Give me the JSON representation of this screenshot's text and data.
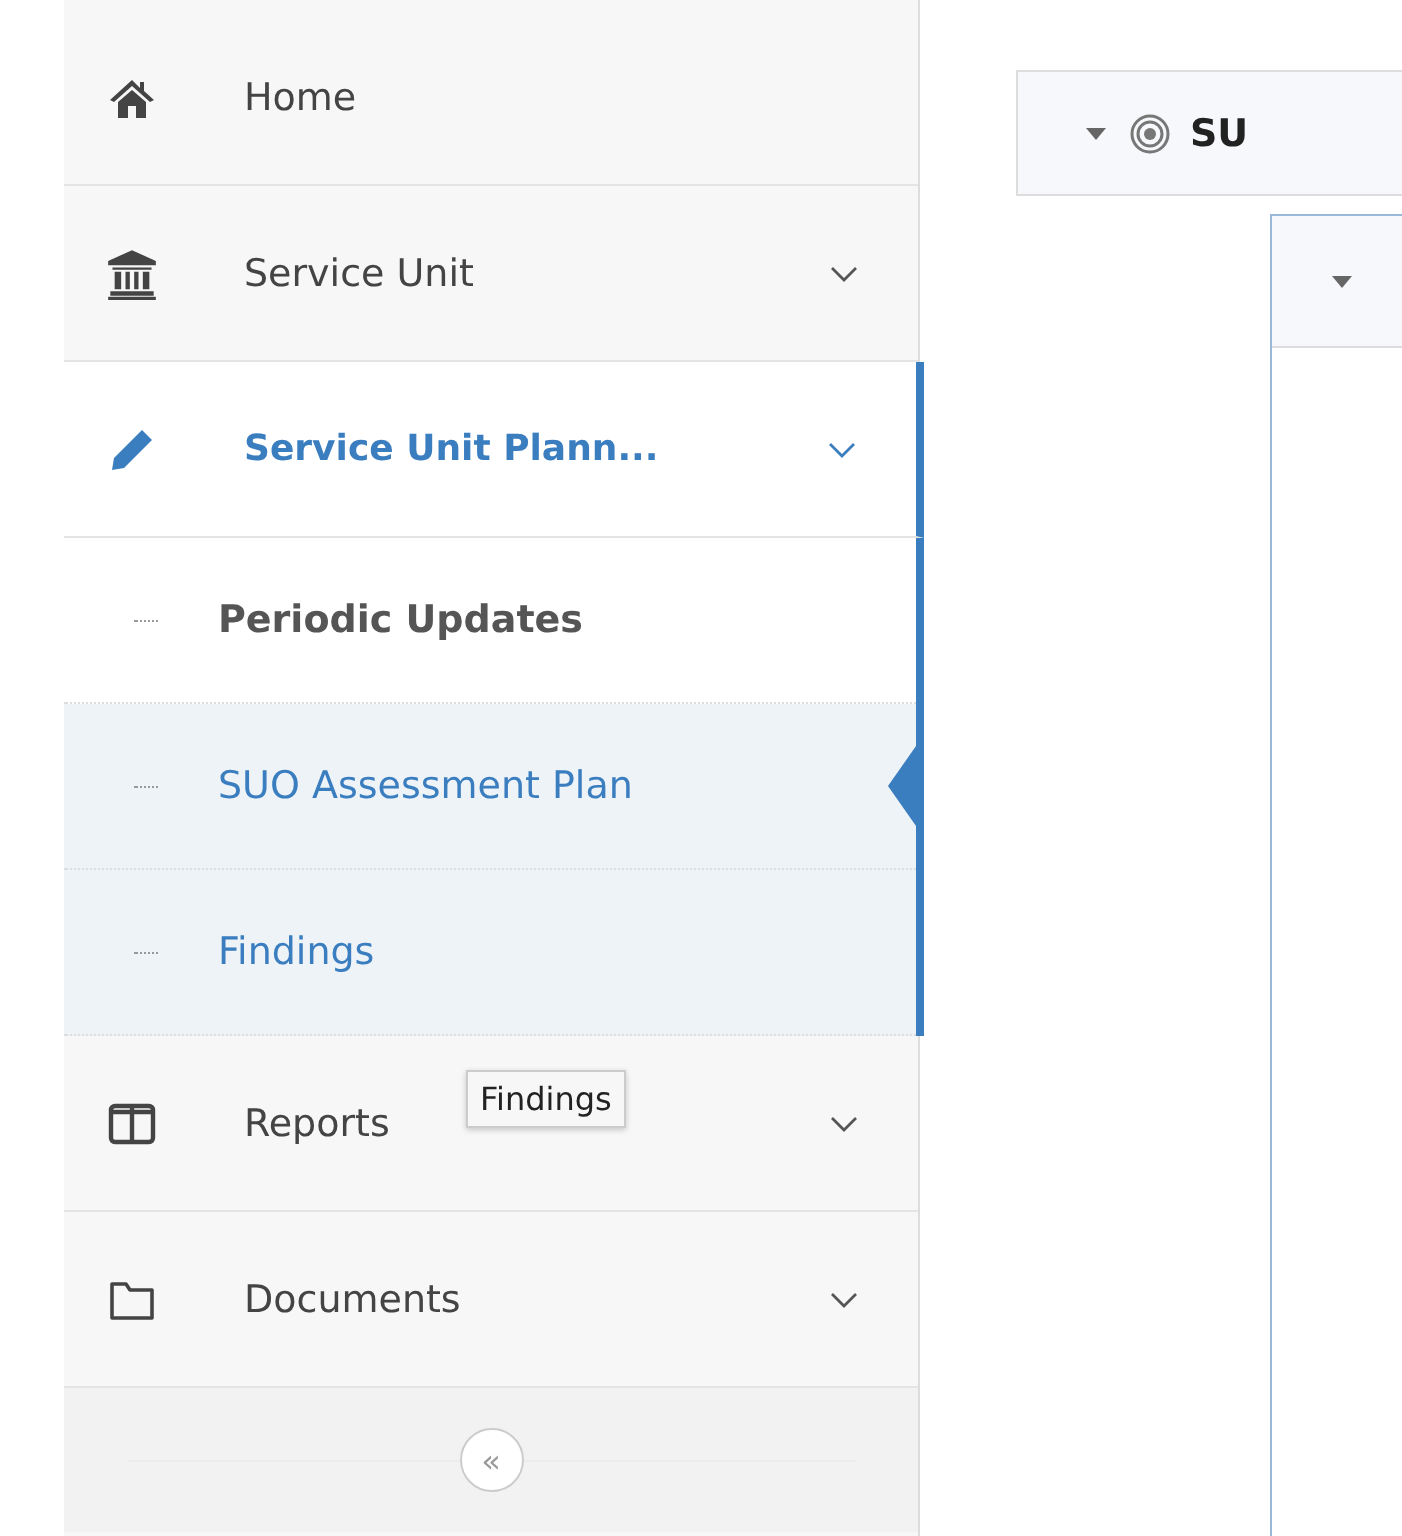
{
  "sidebar": {
    "items": [
      {
        "label": "Home",
        "active": false
      },
      {
        "label": "Service Unit",
        "active": false,
        "expanded": false
      },
      {
        "label": "Service Unit Plann...",
        "active": true,
        "expanded": true,
        "children": [
          {
            "label": "Periodic Updates",
            "selected": false,
            "highlighted": false
          },
          {
            "label": "SUO Assessment Plan",
            "selected": true,
            "highlighted": true
          },
          {
            "label": "Findings",
            "selected": false,
            "highlighted": true
          }
        ]
      },
      {
        "label": "Reports",
        "active": false,
        "expanded": false
      },
      {
        "label": "Documents",
        "active": false,
        "expanded": false
      }
    ],
    "collapse_button": "«"
  },
  "tooltip": "Findings",
  "tree": {
    "node": {
      "label": "SU",
      "expanded": true
    },
    "child": {
      "expanded": true
    }
  }
}
